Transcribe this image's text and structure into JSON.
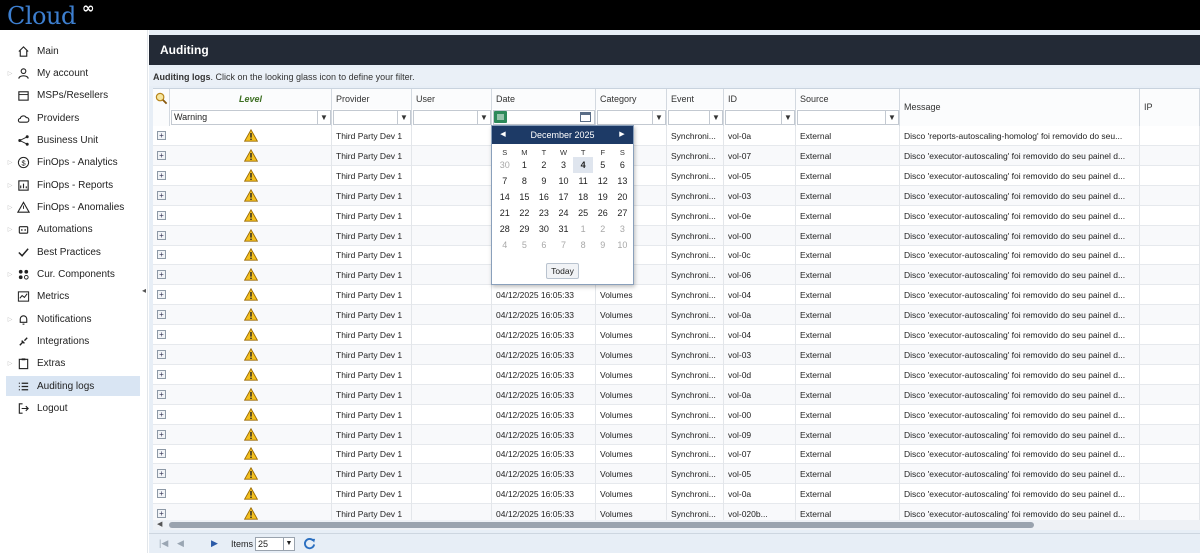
{
  "app": {
    "logo_text": "Cloud",
    "logo_symbol": "∞"
  },
  "sidebar": {
    "items": [
      {
        "label": "Main",
        "icon": "home-icon",
        "arrow": false
      },
      {
        "label": "My account",
        "icon": "user-icon",
        "arrow": true
      },
      {
        "label": "MSPs/Resellers",
        "icon": "building-icon",
        "arrow": false
      },
      {
        "label": "Providers",
        "icon": "cloud-icon",
        "arrow": false
      },
      {
        "label": "Business Unit",
        "icon": "share-icon",
        "arrow": false
      },
      {
        "label": "FinOps - Analytics",
        "icon": "dollar-icon",
        "arrow": true
      },
      {
        "label": "FinOps - Reports",
        "icon": "report-icon",
        "arrow": true
      },
      {
        "label": "FinOps - Anomalies",
        "icon": "warning-icon",
        "arrow": true
      },
      {
        "label": "Automations",
        "icon": "robot-icon",
        "arrow": true
      },
      {
        "label": "Best Practices",
        "icon": "check-icon",
        "arrow": false
      },
      {
        "label": "Cur. Components",
        "icon": "components-icon",
        "arrow": true
      },
      {
        "label": "Metrics",
        "icon": "metrics-icon",
        "arrow": false
      },
      {
        "label": "Notifications",
        "icon": "bell-icon",
        "arrow": true
      },
      {
        "label": "Integrations",
        "icon": "plug-icon",
        "arrow": false
      },
      {
        "label": "Extras",
        "icon": "clipboard-icon",
        "arrow": true
      },
      {
        "label": "Auditing logs",
        "icon": "list-icon",
        "arrow": false,
        "active": true
      },
      {
        "label": "Logout",
        "icon": "logout-icon",
        "arrow": false
      }
    ]
  },
  "page": {
    "title": "Auditing",
    "info_bold": "Auditing logs",
    "info_text": ". Click on the looking glass icon to define your filter."
  },
  "grid": {
    "columns": {
      "level": "Level",
      "provider": "Provider",
      "user": "User",
      "date": "Date",
      "category": "Category",
      "event": "Event",
      "id": "ID",
      "source": "Source",
      "message": "Message",
      "ip": "IP"
    },
    "filters": {
      "level": "Warning"
    },
    "rows": [
      {
        "provider": "Third Party Dev 1",
        "date": "",
        "category": "",
        "event": "Synchroni...",
        "id": "vol-0a",
        "source": "External",
        "message": "Disco 'reports-autoscaling-homolog' foi removido do seu..."
      },
      {
        "provider": "Third Party Dev 1",
        "date": "",
        "category": "",
        "event": "Synchroni...",
        "id": "vol-07",
        "source": "External",
        "message": "Disco 'executor-autoscaling' foi removido do seu painel d..."
      },
      {
        "provider": "Third Party Dev 1",
        "date": "",
        "category": "",
        "event": "Synchroni...",
        "id": "vol-05",
        "source": "External",
        "message": "Disco 'executor-autoscaling' foi removido do seu painel d..."
      },
      {
        "provider": "Third Party Dev 1",
        "date": "",
        "category": "",
        "event": "Synchroni...",
        "id": "vol-03",
        "source": "External",
        "message": "Disco 'executor-autoscaling' foi removido do seu painel d..."
      },
      {
        "provider": "Third Party Dev 1",
        "date": "",
        "category": "",
        "event": "Synchroni...",
        "id": "vol-0e",
        "source": "External",
        "message": "Disco 'executor-autoscaling' foi removido do seu painel d..."
      },
      {
        "provider": "Third Party Dev 1",
        "date": "",
        "category": "",
        "event": "Synchroni...",
        "id": "vol-00",
        "source": "External",
        "message": "Disco 'executor-autoscaling' foi removido do seu painel d..."
      },
      {
        "provider": "Third Party Dev 1",
        "date": "",
        "category": "",
        "event": "Synchroni...",
        "id": "vol-0c",
        "source": "External",
        "message": "Disco 'executor-autoscaling' foi removido do seu painel d..."
      },
      {
        "provider": "Third Party Dev 1",
        "date": "",
        "category": "",
        "event": "Synchroni...",
        "id": "vol-06",
        "source": "External",
        "message": "Disco 'executor-autoscaling' foi removido do seu painel d..."
      },
      {
        "provider": "Third Party Dev 1",
        "date": "04/12/2025 16:05:33",
        "category": "Volumes",
        "event": "Synchroni...",
        "id": "vol-04",
        "source": "External",
        "message": "Disco 'executor-autoscaling' foi removido do seu painel d..."
      },
      {
        "provider": "Third Party Dev 1",
        "date": "04/12/2025 16:05:33",
        "category": "Volumes",
        "event": "Synchroni...",
        "id": "vol-0a",
        "source": "External",
        "message": "Disco 'executor-autoscaling' foi removido do seu painel d..."
      },
      {
        "provider": "Third Party Dev 1",
        "date": "04/12/2025 16:05:33",
        "category": "Volumes",
        "event": "Synchroni...",
        "id": "vol-04",
        "source": "External",
        "message": "Disco 'executor-autoscaling' foi removido do seu painel d..."
      },
      {
        "provider": "Third Party Dev 1",
        "date": "04/12/2025 16:05:33",
        "category": "Volumes",
        "event": "Synchroni...",
        "id": "vol-03",
        "source": "External",
        "message": "Disco 'executor-autoscaling' foi removido do seu painel d..."
      },
      {
        "provider": "Third Party Dev 1",
        "date": "04/12/2025 16:05:33",
        "category": "Volumes",
        "event": "Synchroni...",
        "id": "vol-0d",
        "source": "External",
        "message": "Disco 'executor-autoscaling' foi removido do seu painel d..."
      },
      {
        "provider": "Third Party Dev 1",
        "date": "04/12/2025 16:05:33",
        "category": "Volumes",
        "event": "Synchroni...",
        "id": "vol-0a",
        "source": "External",
        "message": "Disco 'executor-autoscaling' foi removido do seu painel d..."
      },
      {
        "provider": "Third Party Dev 1",
        "date": "04/12/2025 16:05:33",
        "category": "Volumes",
        "event": "Synchroni...",
        "id": "vol-00",
        "source": "External",
        "message": "Disco 'executor-autoscaling' foi removido do seu painel d..."
      },
      {
        "provider": "Third Party Dev 1",
        "date": "04/12/2025 16:05:33",
        "category": "Volumes",
        "event": "Synchroni...",
        "id": "vol-09",
        "source": "External",
        "message": "Disco 'executor-autoscaling' foi removido do seu painel d..."
      },
      {
        "provider": "Third Party Dev 1",
        "date": "04/12/2025 16:05:33",
        "category": "Volumes",
        "event": "Synchroni...",
        "id": "vol-07",
        "source": "External",
        "message": "Disco 'executor-autoscaling' foi removido do seu painel d..."
      },
      {
        "provider": "Third Party Dev 1",
        "date": "04/12/2025 16:05:33",
        "category": "Volumes",
        "event": "Synchroni...",
        "id": "vol-05",
        "source": "External",
        "message": "Disco 'executor-autoscaling' foi removido do seu painel d..."
      },
      {
        "provider": "Third Party Dev 1",
        "date": "04/12/2025 16:05:33",
        "category": "Volumes",
        "event": "Synchroni...",
        "id": "vol-0a",
        "source": "External",
        "message": "Disco 'executor-autoscaling' foi removido do seu painel d..."
      },
      {
        "provider": "Third Party Dev 1",
        "date": "04/12/2025 16:05:33",
        "category": "Volumes",
        "event": "Synchroni...",
        "id": "vol-020b...",
        "source": "External",
        "message": "Disco 'executor-autoscaling' foi removido do seu painel d..."
      }
    ]
  },
  "calendar": {
    "month_label": "December 2025",
    "weekdays": [
      "S",
      "M",
      "T",
      "W",
      "T",
      "F",
      "S"
    ],
    "weeks": [
      [
        "30",
        "1",
        "2",
        "3",
        "4",
        "5",
        "6"
      ],
      [
        "7",
        "8",
        "9",
        "10",
        "11",
        "12",
        "13"
      ],
      [
        "14",
        "15",
        "16",
        "17",
        "18",
        "19",
        "20"
      ],
      [
        "21",
        "22",
        "23",
        "24",
        "25",
        "26",
        "27"
      ],
      [
        "28",
        "29",
        "30",
        "31",
        "1",
        "2",
        "3"
      ],
      [
        "4",
        "5",
        "6",
        "7",
        "8",
        "9",
        "10"
      ]
    ],
    "selected": "4",
    "today_label": "Today"
  },
  "footer": {
    "items_label": "Items",
    "page_size": "25"
  },
  "colors": {
    "header_bg": "#232a36",
    "calendar_header": "#1d3a66",
    "level_header": "#3c6e21",
    "accent": "#3d7fd0"
  }
}
